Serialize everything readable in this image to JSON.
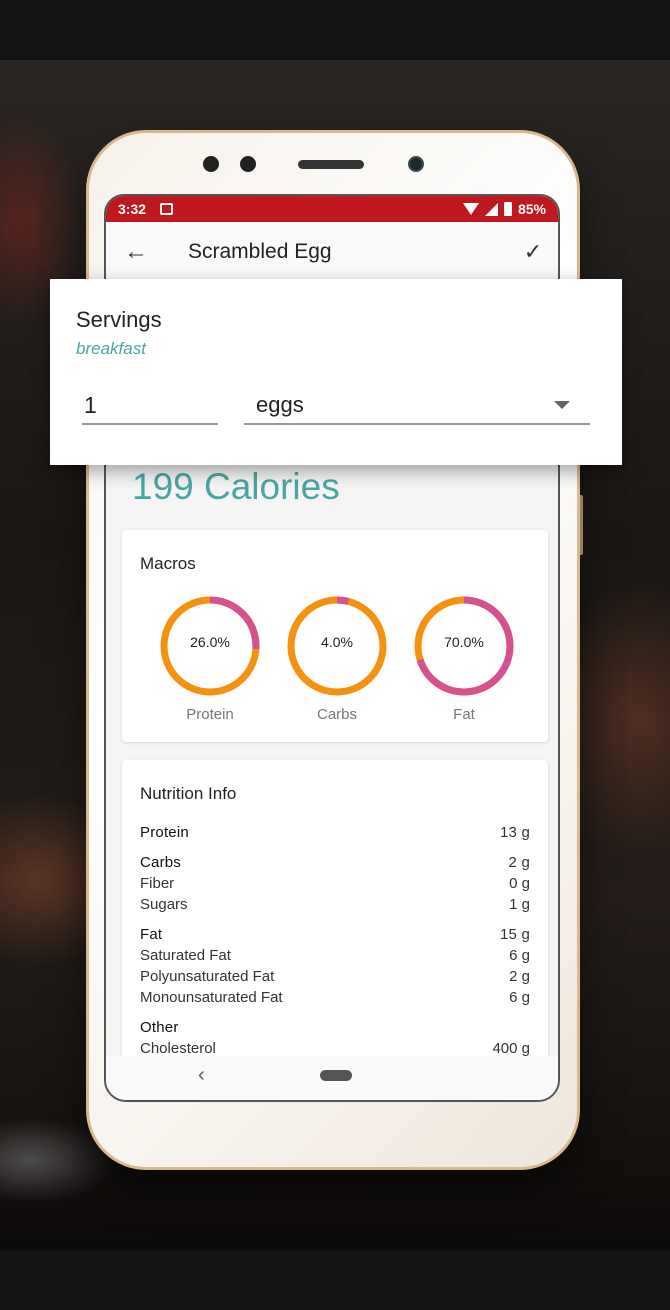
{
  "status_bar": {
    "time": "3:32",
    "battery": "85%"
  },
  "app_bar": {
    "back_icon": "←",
    "title": "Scrambled Egg",
    "confirm_icon": "✓"
  },
  "servings_dialog": {
    "title": "Servings",
    "subtitle": "breakfast",
    "quantity": "1",
    "unit": "eggs"
  },
  "calories": "199 Calories",
  "macros": {
    "title": "Macros",
    "items": [
      {
        "label": "Protein",
        "percent_text": "26.0%",
        "fraction": 0.26
      },
      {
        "label": "Carbs",
        "percent_text": "4.0%",
        "fraction": 0.04
      },
      {
        "label": "Fat",
        "percent_text": "70.0%",
        "fraction": 0.7
      }
    ],
    "colors": {
      "highlight": "#d6518f",
      "rest": "#f39110"
    }
  },
  "nutrition": {
    "title": "Nutrition Info",
    "rows": [
      {
        "name": "Protein",
        "value": "13 g",
        "bold": true
      },
      {
        "name": "Carbs",
        "value": "2 g",
        "bold": true
      },
      {
        "name": "Fiber",
        "value": "0 g",
        "bold": false
      },
      {
        "name": "Sugars",
        "value": "1 g",
        "bold": false
      },
      {
        "name": "Fat",
        "value": "15 g",
        "bold": true
      },
      {
        "name": "Saturated Fat",
        "value": "6 g",
        "bold": false
      },
      {
        "name": "Polyunsaturated Fat",
        "value": "2 g",
        "bold": false
      },
      {
        "name": "Monounsaturated Fat",
        "value": "6 g",
        "bold": false
      },
      {
        "name": "Other",
        "value": "",
        "bold": true
      },
      {
        "name": "Cholesterol",
        "value": "400 g",
        "bold": false
      }
    ]
  },
  "nav_bar": {
    "back_icon": "‹"
  },
  "colors": {
    "status_bar": "#c0181f",
    "accent": "#49a7a3"
  }
}
